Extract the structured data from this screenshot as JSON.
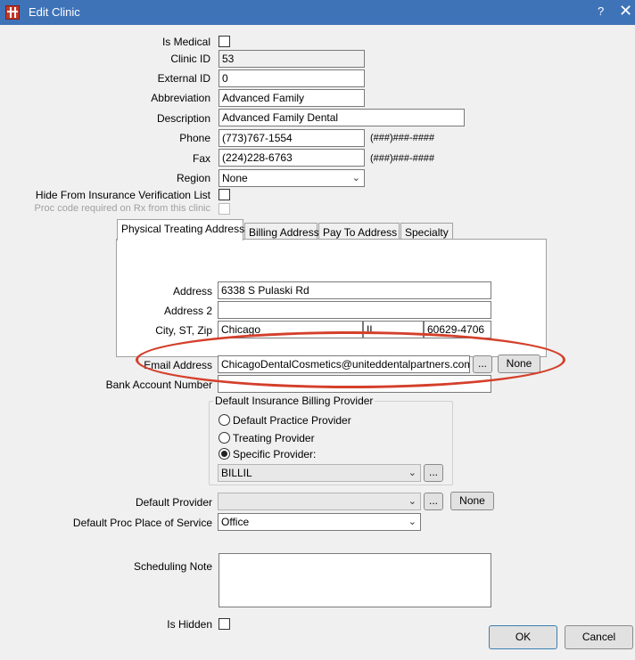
{
  "window": {
    "title": "Edit Clinic",
    "help": "?",
    "close": "✕"
  },
  "fields": {
    "is_medical_label": "Is Medical",
    "clinic_id_label": "Clinic ID",
    "clinic_id_value": "53",
    "external_id_label": "External ID",
    "external_id_value": "0",
    "abbreviation_label": "Abbreviation",
    "abbreviation_value": "Advanced Family",
    "description_label": "Description",
    "description_value": "Advanced Family Dental",
    "phone_label": "Phone",
    "phone_value": "(773)767-1554",
    "phone_format": "(###)###-####",
    "fax_label": "Fax",
    "fax_value": "(224)228-6763",
    "fax_format": "(###)###-####",
    "region_label": "Region",
    "region_value": "None",
    "hide_insurance_label": "Hide From Insurance Verification List",
    "proc_code_label": "Proc code required on Rx from this clinic"
  },
  "tabs": [
    {
      "label": "Physical Treating Address"
    },
    {
      "label": "Billing Address"
    },
    {
      "label": "Pay To Address"
    },
    {
      "label": "Specialty"
    }
  ],
  "address": {
    "address_label": "Address",
    "address_value": "6338 S Pulaski Rd",
    "address2_label": "Address 2",
    "address2_value": "",
    "city_label": "City, ST, Zip",
    "city_value": "Chicago",
    "state_value": "IL",
    "zip_value": "60629-4706"
  },
  "email": {
    "label": "Email Address",
    "value": "ChicagoDentalCosmetics@uniteddentalpartners.com",
    "browse": "...",
    "none": "None"
  },
  "bank": {
    "label": "Bank Account Number",
    "value": ""
  },
  "billing": {
    "title": "Default Insurance Billing Provider",
    "option_practice": "Default Practice Provider",
    "option_treating": "Treating Provider",
    "option_specific": "Specific Provider:",
    "selected": "specific",
    "provider_value": "BILLIL",
    "browse": "..."
  },
  "default_provider": {
    "label": "Default Provider",
    "value": "",
    "browse": "...",
    "none": "None"
  },
  "place_of_service": {
    "label": "Default Proc Place of Service",
    "value": "Office"
  },
  "scheduling": {
    "label": "Scheduling Note",
    "value": ""
  },
  "is_hidden": {
    "label": "Is Hidden"
  },
  "buttons": {
    "ok": "OK",
    "cancel": "Cancel"
  },
  "colors": {
    "titlebar": "#3f73b8",
    "highlight": "#d43f2a"
  },
  "icons": {
    "app": "open-dental-grid-icon",
    "dropdown": "chevron-down-icon"
  }
}
